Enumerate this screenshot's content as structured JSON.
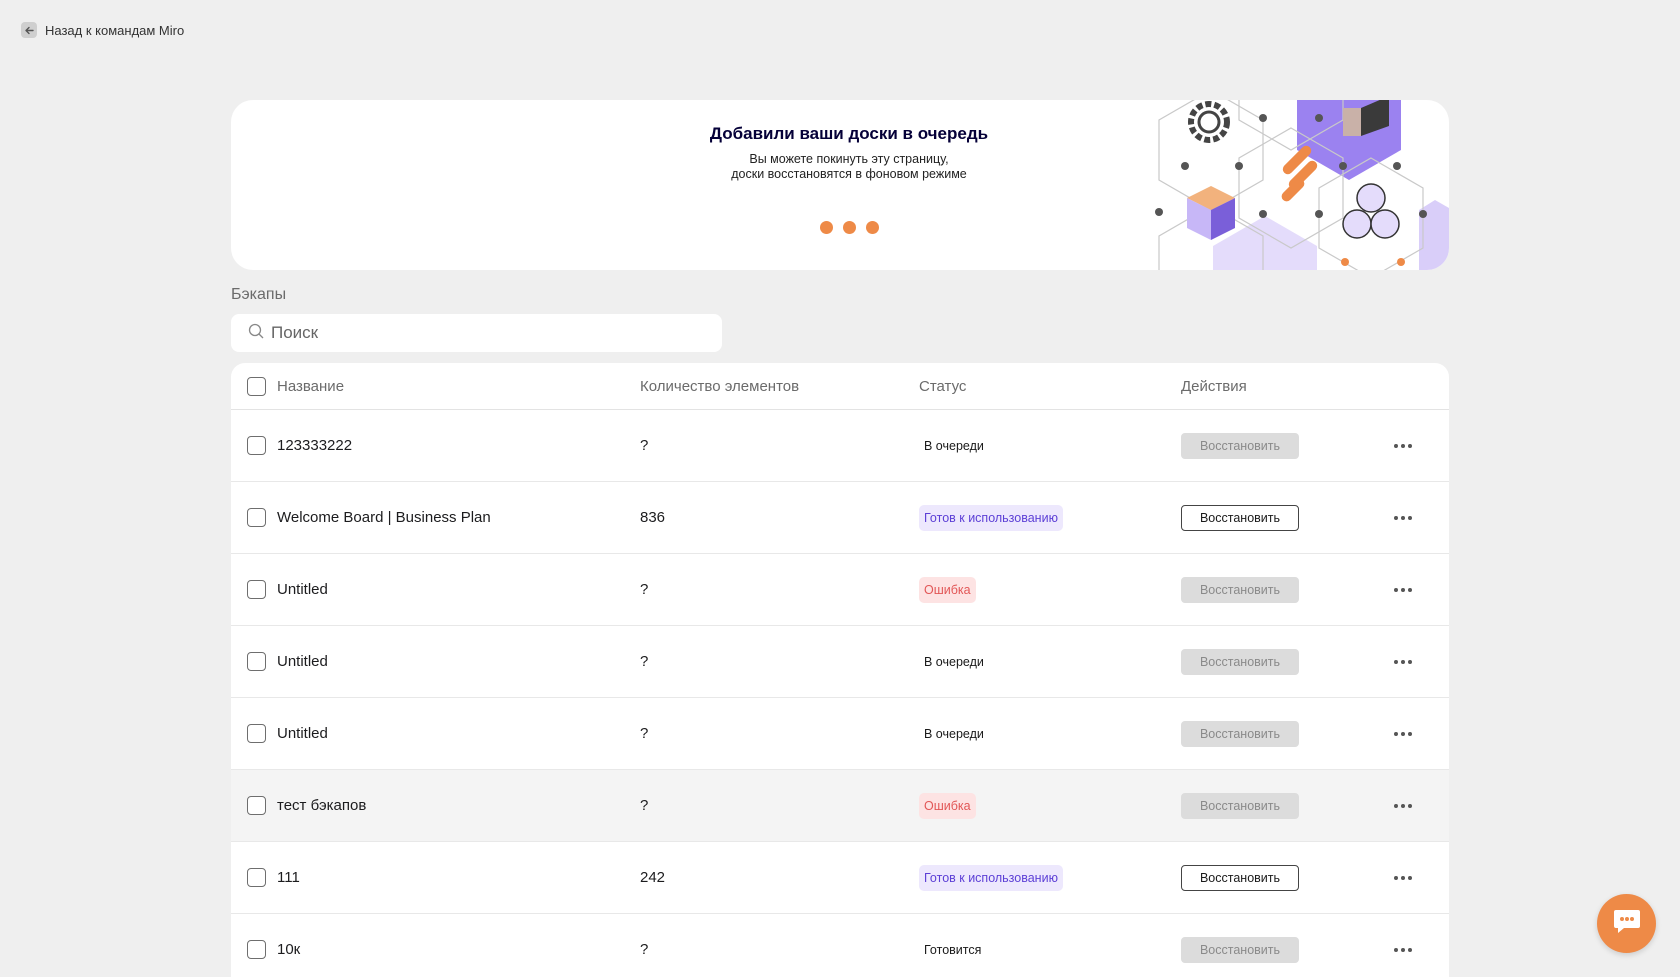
{
  "back": {
    "label": "Назад к командам Miro",
    "icon": "arrow-left-icon"
  },
  "banner": {
    "title": "Добавили ваши доски в очередь",
    "subtitle_line1": "Вы можете покинуть эту страницу,",
    "subtitle_line2": "доски восстановятся в фоновом режиме",
    "accent": "#ee8a47"
  },
  "section": {
    "label": "Бэкапы"
  },
  "search": {
    "placeholder": "Поиск",
    "value": "",
    "icon": "search-icon"
  },
  "table": {
    "columns": [
      "Название",
      "Количество элементов",
      "Статус",
      "Действия"
    ],
    "rows": [
      {
        "name": "123333222",
        "count": "?",
        "status": "В очереди",
        "status_type": "plain",
        "action": "Восстановить",
        "action_enabled": false
      },
      {
        "name": "Welcome Board | Business Plan",
        "count": "836",
        "status": "Готов к использованию",
        "status_type": "ready",
        "action": "Восстановить",
        "action_enabled": true
      },
      {
        "name": "Untitled",
        "count": "?",
        "status": "Ошибка",
        "status_type": "error",
        "action": "Восстановить",
        "action_enabled": false
      },
      {
        "name": "Untitled",
        "count": "?",
        "status": "В очереди",
        "status_type": "plain",
        "action": "Восстановить",
        "action_enabled": false
      },
      {
        "name": "Untitled",
        "count": "?",
        "status": "В очереди",
        "status_type": "plain",
        "action": "Восстановить",
        "action_enabled": false
      },
      {
        "name": "тест бэкапов",
        "count": "?",
        "status": "Ошибка",
        "status_type": "error",
        "action": "Восстановить",
        "action_enabled": false
      },
      {
        "name": "111",
        "count": "242",
        "status": "Готов к использованию",
        "status_type": "ready",
        "action": "Восстановить",
        "action_enabled": true
      },
      {
        "name": "10к",
        "count": "?",
        "status": "Готовится",
        "status_type": "plain",
        "action": "Восстановить",
        "action_enabled": false
      }
    ]
  },
  "chat": {
    "icon": "chat-icon",
    "color": "#ee8a47"
  }
}
